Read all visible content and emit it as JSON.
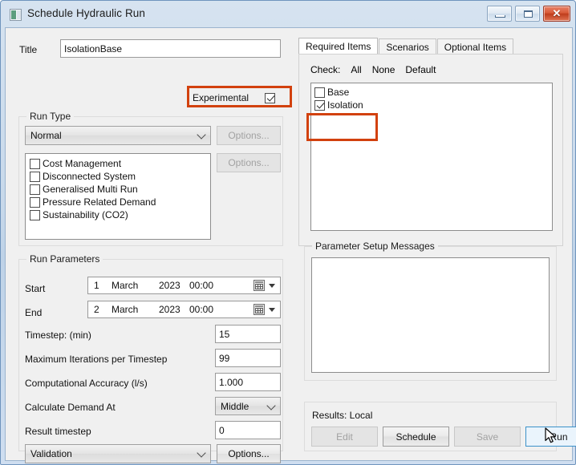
{
  "window": {
    "title": "Schedule Hydraulic Run",
    "icon": "app-icon",
    "buttons": {
      "minimize": "minimize",
      "maximize": "maximize",
      "close": "✕"
    }
  },
  "left": {
    "title_label": "Title",
    "title_value": "IsolationBase",
    "experimental": {
      "label": "Experimental",
      "checked": true,
      "highlighted": true
    },
    "run_type": {
      "legend": "Run Type",
      "combo_value": "Normal",
      "options_button": "Options...",
      "options_button_2": "Options...",
      "checkboxes": [
        {
          "label": "Cost Management",
          "checked": false
        },
        {
          "label": "Disconnected System",
          "checked": false
        },
        {
          "label": "Generalised Multi Run",
          "checked": false
        },
        {
          "label": "Pressure Related Demand",
          "checked": false
        },
        {
          "label": "Sustainability (CO2)",
          "checked": false
        }
      ]
    },
    "run_parameters": {
      "legend": "Run Parameters",
      "start_label": "Start",
      "start": {
        "day": "1",
        "month": "March",
        "year": "2023",
        "time": "00:00"
      },
      "end_label": "End",
      "end": {
        "day": "2",
        "month": "March",
        "year": "2023",
        "time": "00:00"
      },
      "rows": [
        {
          "label": "Timestep: (min)",
          "value": "15"
        },
        {
          "label": "Maximum Iterations per Timestep",
          "value": "99"
        },
        {
          "label": "Computational Accuracy (l/s)",
          "value": "1.000"
        }
      ],
      "calculate_demand_label": "Calculate Demand At",
      "calculate_demand_value": "Middle",
      "result_timestep_label": "Result timestep",
      "result_timestep_value": "0",
      "validation_combo": "Validation",
      "validation_options_button": "Options..."
    }
  },
  "right": {
    "tabs": [
      {
        "label": "Required Items",
        "active": true
      },
      {
        "label": "Scenarios",
        "active": false
      },
      {
        "label": "Optional Items",
        "active": false
      }
    ],
    "check": {
      "label": "Check:",
      "all": "All",
      "none": "None",
      "default": "Default"
    },
    "scenario_items": [
      {
        "label": "Base",
        "checked": false
      },
      {
        "label": "Isolation",
        "checked": true
      }
    ],
    "scenario_highlighted": true,
    "messages": {
      "legend": "Parameter Setup Messages",
      "content": ""
    },
    "results": {
      "label": "Results: Local",
      "buttons": [
        {
          "label": "Edit",
          "state": "disabled"
        },
        {
          "label": "Schedule",
          "state": "normal"
        },
        {
          "label": "Save",
          "state": "disabled"
        },
        {
          "label": "Run",
          "state": "hover"
        }
      ]
    }
  },
  "colors": {
    "highlight": "#d2410e",
    "hover_border": "#3c92c9",
    "hover_fill": "#eaf4fc",
    "close_button": "#bf3d1c"
  }
}
